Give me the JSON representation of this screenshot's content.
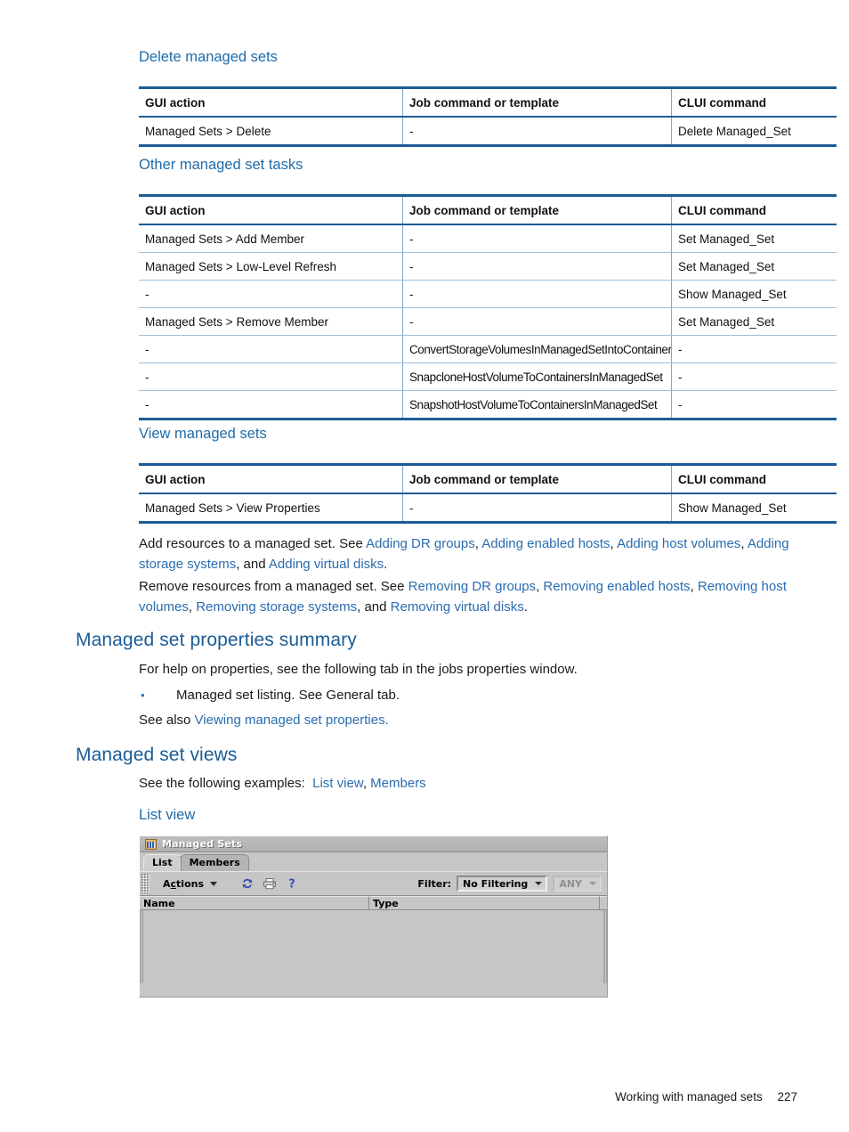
{
  "page": {
    "footer_text": "Working with managed sets",
    "page_number": "227"
  },
  "sections": {
    "delete_managed_sets": {
      "heading": "Delete managed sets"
    },
    "other_managed_set_tasks": {
      "heading": "Other managed set tasks"
    },
    "view_managed_sets": {
      "heading": "View managed sets"
    },
    "managed_set_properties_summary": {
      "heading": "Managed set properties summary",
      "intro": "For help on properties, see the following tab in the jobs properties window.",
      "bullet": "Managed set listing. See General tab.",
      "see_also_prefix": "See also ",
      "see_also_link": "Viewing managed set properties.",
      "bullet_glyph": "•"
    },
    "managed_set_views": {
      "heading": "Managed set views",
      "intro_prefix": "See the following examples:  ",
      "link_list_view": "List view",
      "separator": ", ",
      "link_members": "Members",
      "subheading_list_view": "List view"
    }
  },
  "table_columns": {
    "gui_action": "GUI action",
    "job_command": "Job command or template",
    "clui_command": "CLUI command"
  },
  "tables": {
    "delete": {
      "rows": [
        {
          "gui": "Managed Sets > Delete",
          "job": "-",
          "clui": "Delete Managed_Set"
        }
      ]
    },
    "other": {
      "rows": [
        {
          "gui": "Managed Sets > Add Member",
          "job": "-",
          "clui": "Set Managed_Set"
        },
        {
          "gui": "Managed Sets > Low-Level Refresh",
          "job": "-",
          "clui": "Set Managed_Set"
        },
        {
          "gui": "-",
          "job": "-",
          "clui": "Show Managed_Set"
        },
        {
          "gui": "Managed Sets > Remove Member",
          "job": "-",
          "clui": "Set Managed_Set"
        },
        {
          "gui": "-",
          "job": "ConvertStorageVolumesInManagedSetIntoContainers",
          "clui": "-"
        },
        {
          "gui": "-",
          "job": "SnapcloneHostVolumeToContainersInManagedSet",
          "clui": "-"
        },
        {
          "gui": "-",
          "job": "SnapshotHostVolumeToContainersInManagedSet",
          "clui": "-"
        }
      ]
    },
    "view": {
      "rows": [
        {
          "gui": "Managed Sets > View Properties",
          "job": "-",
          "clui": "Show Managed_Set"
        }
      ]
    }
  },
  "paragraphs": {
    "add_resources": {
      "t1": "Add resources to a managed set. See ",
      "l1": "Adding DR groups",
      "t2": ", ",
      "l2": "Adding enabled hosts",
      "t3": ", ",
      "l3": "Adding host volumes",
      "t4": ", ",
      "l4": "Adding storage systems",
      "t5": ", and ",
      "l5": "Adding virtual disks",
      "t6": "."
    },
    "remove_resources": {
      "t1": "Remove resources from a managed set. See ",
      "l1": "Removing DR groups",
      "t2": ", ",
      "l2": "Removing enabled hosts",
      "t3": ", ",
      "l3": "Removing host volumes",
      "t4": ", ",
      "l4": "Removing storage systems",
      "t5": ", and ",
      "l5": "Removing virtual disks",
      "t6": "."
    }
  },
  "app_window": {
    "title": "Managed Sets",
    "tabs": [
      {
        "label": "List",
        "selected": true
      },
      {
        "label": "Members",
        "selected": false
      }
    ],
    "toolbar": {
      "actions_label_pre": "A",
      "actions_label_accel": "c",
      "actions_label_post": "tions",
      "icons": [
        "refresh-icon",
        "print-icon",
        "help-icon"
      ]
    },
    "filter": {
      "label": "Filter:",
      "selected_value": "No Filtering",
      "secondary_value": "ANY",
      "secondary_disabled": true
    },
    "list_columns": [
      "Name",
      "Type"
    ],
    "rows": []
  },
  "colors": {
    "heading_blue": "#1b5c96",
    "link_blue": "#2b6cb0",
    "table_rule": "#1b5c96",
    "app_face": "#c6c6c6"
  }
}
